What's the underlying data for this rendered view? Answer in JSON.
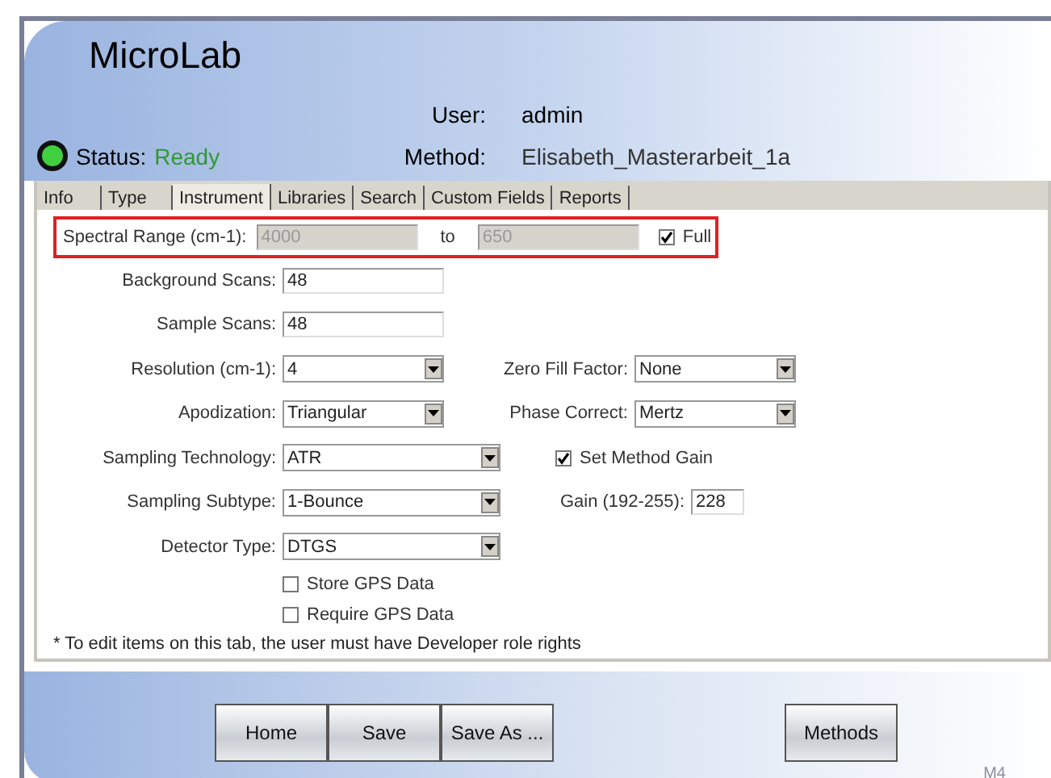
{
  "header": {
    "app_title": "MicroLab",
    "user_label": "User:",
    "user": "admin",
    "status_label": "Status:",
    "status": "Ready",
    "status_ok": true,
    "method_label": "Method:",
    "method": "Elisabeth_Masterarbeit_1a"
  },
  "tabs": [
    {
      "label": "Info",
      "selected": false
    },
    {
      "label": "Type",
      "selected": false
    },
    {
      "label": "Instrument",
      "selected": true
    },
    {
      "label": "Libraries",
      "selected": false
    },
    {
      "label": "Search",
      "selected": false
    },
    {
      "label": "Custom Fields",
      "selected": false
    },
    {
      "label": "Reports",
      "selected": false
    }
  ],
  "spectral_range": {
    "label": "Spectral Range (cm-1):",
    "from": "4000",
    "to_label": "to",
    "to": "650",
    "disabled": true,
    "full": {
      "label": "Full",
      "checked": true
    }
  },
  "rows": [
    {
      "label": "Background Scans:",
      "kind": "text",
      "value": "48"
    },
    {
      "label": "Sample Scans:",
      "kind": "text",
      "value": "48"
    },
    {
      "label": "Resolution (cm-1):",
      "kind": "select",
      "value": "4",
      "right": {
        "label": "Zero Fill Factor:",
        "kind": "select",
        "value": "None"
      }
    },
    {
      "label": "Apodization:",
      "kind": "select",
      "value": "Triangular",
      "right": {
        "label": "Phase Correct:",
        "kind": "select",
        "value": "Mertz"
      }
    },
    {
      "label": "Sampling Technology:",
      "kind": "select-wide",
      "value": "ATR",
      "right": {
        "kind": "checkbox",
        "label": "Set Method Gain",
        "checked": true
      }
    },
    {
      "label": "Sampling Subtype:",
      "kind": "select-wide",
      "value": "1-Bounce",
      "right": {
        "label": "Gain (192-255):",
        "kind": "text-small",
        "value": "228"
      }
    },
    {
      "label": "Detector Type:",
      "kind": "select-wide",
      "value": "DTGS"
    },
    {
      "kind": "checkbox",
      "label": "Store GPS Data",
      "checked": false
    },
    {
      "kind": "checkbox",
      "label": "Require GPS Data",
      "checked": false
    }
  ],
  "footnote": "* To edit items on this tab, the user must have Developer role rights",
  "buttons": [
    {
      "label": "Home"
    },
    {
      "label": "Save"
    },
    {
      "label": "Save As ..."
    }
  ],
  "side_button": {
    "label": "Methods"
  },
  "corner_mark": "M4"
}
